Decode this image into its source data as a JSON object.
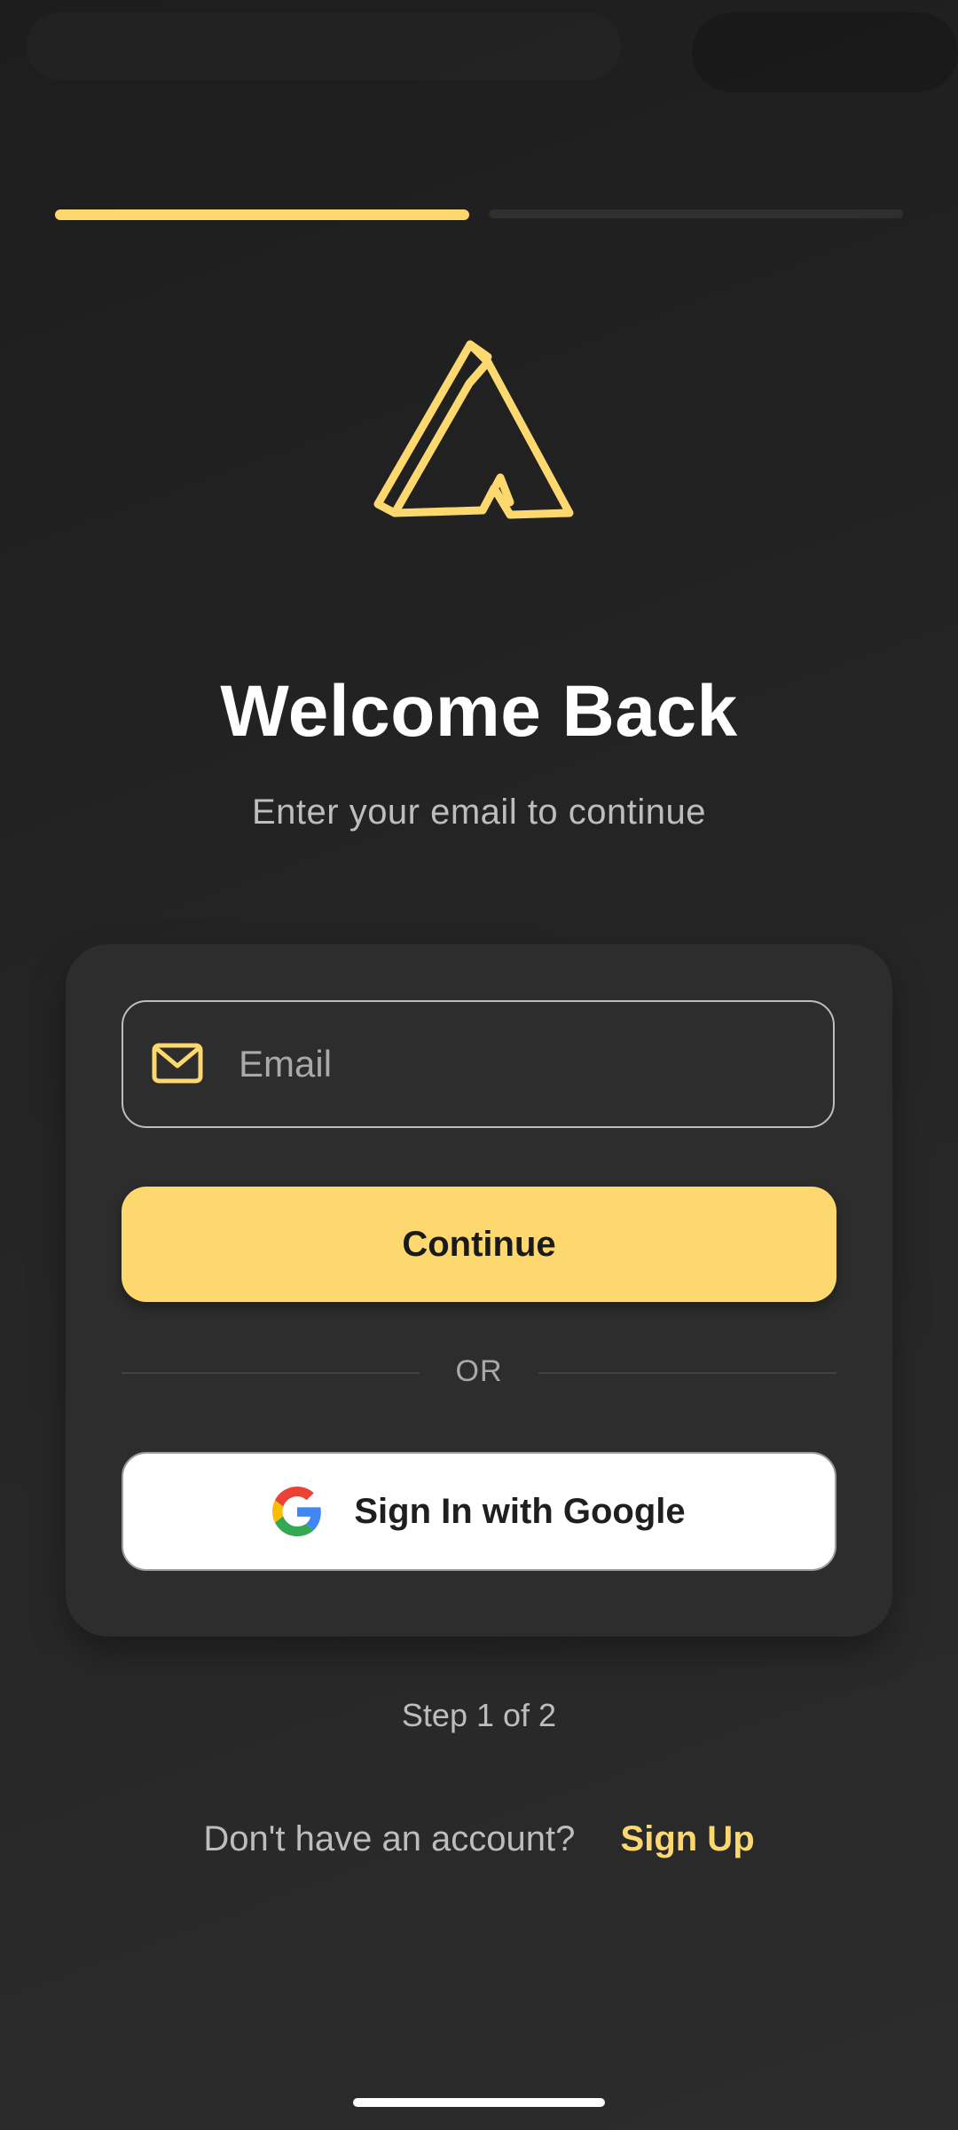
{
  "progress": {
    "current_step": 1,
    "total_steps": 2,
    "fill_fraction": 0.5
  },
  "header": {
    "title": "Welcome Back",
    "subtitle": "Enter your email to continue"
  },
  "form": {
    "email_placeholder": "Email",
    "email_value": "",
    "email_icon": "mail-icon",
    "continue_label": "Continue",
    "divider_label": "OR",
    "google_label": "Sign In with Google",
    "google_icon": "google-icon"
  },
  "footer": {
    "step_text": "Step 1 of 2",
    "signup_prompt": "Don't have an account?",
    "signup_link": "Sign Up"
  },
  "colors": {
    "accent": "#fcd86e",
    "background": "#222222",
    "card": "#2d2d2d",
    "muted_text": "#bdbdbd"
  }
}
